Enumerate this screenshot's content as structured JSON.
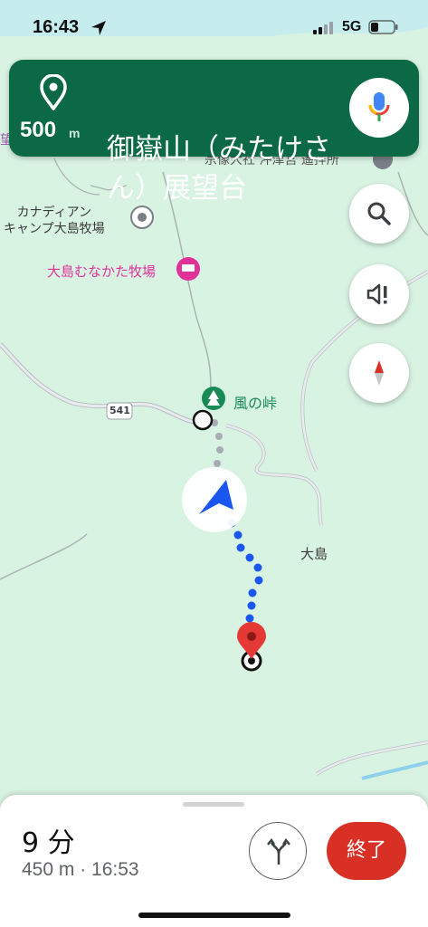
{
  "status_bar": {
    "time": "16:43",
    "network": "5G",
    "icons": [
      "location-arrow-icon",
      "signal-icon",
      "battery-icon"
    ]
  },
  "navigation": {
    "distance_value": "500",
    "distance_unit": "m",
    "destination": "御嶽山（みたけさん）展望台",
    "icons": [
      "location-pin-icon",
      "microphone-icon"
    ]
  },
  "map": {
    "labels": {
      "top_left_fragment": "望",
      "top_right": "宗像大社 沖津宮 遙拝所",
      "campground": "カナディアン\nキャンプ大島牧場",
      "lodging": "大島むなかた牧場",
      "pass": "風の峠",
      "road_number": "541",
      "island": "大島"
    }
  },
  "controls": {
    "icons": [
      "search-icon",
      "sound-alert-icon",
      "compass-icon"
    ]
  },
  "trip": {
    "duration": "9 分",
    "details": "450 m · 16:53",
    "end_label": "終了",
    "icons": [
      "alternate-routes-icon"
    ]
  },
  "colors": {
    "nav_card": "#0b6a45",
    "map_bg": "#d9f3e3",
    "route_blue": "#1a56f0",
    "end_button": "#d93025",
    "lodging_pink": "#e0319b",
    "poi_green": "#188a55",
    "destination_pin": "#e53935"
  }
}
